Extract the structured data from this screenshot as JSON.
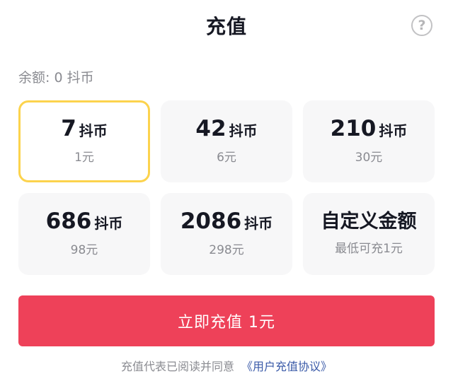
{
  "header": {
    "title": "充值",
    "help_icon": "question-circle-icon",
    "help_glyph": "?"
  },
  "balance": {
    "text": "余额: 0 抖币"
  },
  "options": [
    {
      "amount": "7",
      "unit": "抖币",
      "price": "1元",
      "selected": true
    },
    {
      "amount": "42",
      "unit": "抖币",
      "price": "6元",
      "selected": false
    },
    {
      "amount": "210",
      "unit": "抖币",
      "price": "30元",
      "selected": false
    },
    {
      "amount": "686",
      "unit": "抖币",
      "price": "98元",
      "selected": false
    },
    {
      "amount": "2086",
      "unit": "抖币",
      "price": "298元",
      "selected": false
    }
  ],
  "custom_option": {
    "label": "自定义金额",
    "hint": "最低可充1元"
  },
  "pay_button": {
    "label": "立即充值 1元"
  },
  "agreement": {
    "prefix": "充值代表已阅读并同意",
    "link": "《用户充值协议》"
  },
  "colors": {
    "accent": "#ee4159",
    "selected_border": "#fcd34d",
    "tile_bg": "#f7f7f8",
    "muted_text": "#8a8b91",
    "link": "#3a5aa8"
  }
}
